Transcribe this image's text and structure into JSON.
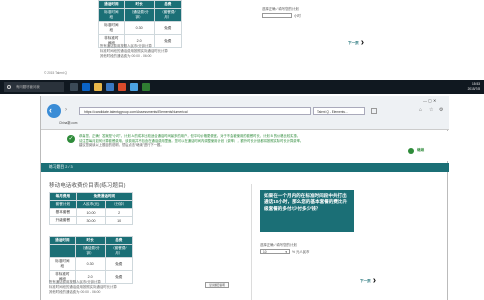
{
  "top_screenshot": {
    "table": {
      "headers": [
        "通话时间",
        "时长",
        "总费"
      ],
      "rows": [
        [
          "标准时间段",
          "（通话费/分钟）",
          "（套餐费/月）"
        ],
        [
          "标准时间段",
          "0.30",
          "免费"
        ],
        [
          "非标准时间段",
          "2.0",
          "免费"
        ]
      ]
    },
    "notes": [
      "所有通话费用按照人民币/分钟计算",
      "标准时间段的通话费用按照实际通话时长计算",
      "其他时段的通话费为 00:00 - 06:00"
    ],
    "right_label": "选择正确 / 填写您的计划",
    "select_value": "",
    "select_suffix": "小时",
    "next_label": "下一页",
    "footer": "© 2015 Talent Q"
  },
  "taskbar": {
    "search_placeholder": "有问题尽管问我",
    "time": "15:53",
    "date": "2015/7/8"
  },
  "browser": {
    "url": "https://candidate.talentqgroup.com/Assessments/ElementsNumerical",
    "tab_title": "Talent Q - Elements...",
    "favorite": "China新.com",
    "feedback": [
      "恭喜您，正确！答案是“小时”。计划 A 的成本比较适合通话时间最多的用户，但平均价格更便宜。对于不会被使用的套餐时长，计划 B 的价格比较实惠。",
      "请注意每月如何计算套餐费用，该费用并不包含在通话费用里面。您可以在通话时间内调整使用计划（费率），额外时长计划都将按照实际时长计算费率。",
      "建议您阅读以上题目的说明，然后点击“继续”进行下一题。"
    ],
    "continue_label": "继续",
    "progress_label": "练习题目 2 / 3",
    "page_title": "移动电话收费价目表(练习题目)",
    "table": {
      "header1": [
        "每月费用",
        "免费通话时间"
      ],
      "header2": [
        "套餐计划",
        "人民币(元)",
        "（分钟）"
      ],
      "rows": [
        [
          "基本套餐",
          "10.00",
          "2"
        ],
        [
          "升级套餐",
          "30.00",
          "10"
        ]
      ],
      "header3": [
        "通话时间",
        "时长",
        "总费"
      ],
      "header4": [
        "",
        "（通话费/分钟）",
        "（套餐费/月）"
      ],
      "rows2": [
        [
          "标准时间段",
          "0.30",
          "免费"
        ],
        [
          "非标准时间段",
          "2.0",
          "免费"
        ]
      ]
    },
    "notes": [
      "所有通话费用按照人民币/分钟计算",
      "标准时间段的通话费用按照实际通话时长计算",
      "其他时段的通话费为 00:00 - 06:00"
    ],
    "question": "如果在一个月内的在标准时间段中共打出通话10小时，那么您的基本套餐的费比升级套餐的多付/少付多少钱？",
    "answer_label": "选择正确 / 填写您的计划",
    "answer_select": "10",
    "answer_unit": "% 元人民币",
    "next_label": "下一页",
    "hint_label": "显示题目说明"
  },
  "colors": {
    "teal": "#1b6f76",
    "green": "#2e8b3a",
    "taskbar": "#101820"
  }
}
